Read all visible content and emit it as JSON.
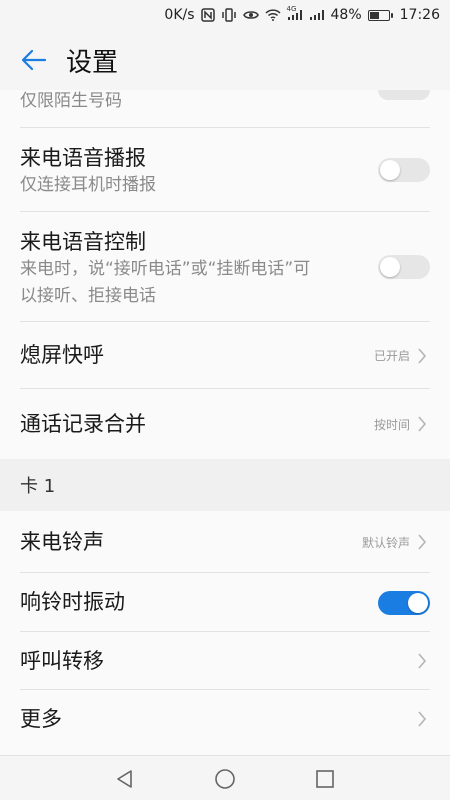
{
  "status_bar": {
    "speed": "0K/s",
    "network_label": "4G",
    "battery": "48%",
    "battery_level": 0.48,
    "time": "17:26"
  },
  "header": {
    "title": "设置"
  },
  "rows": {
    "partial": {
      "sub": "仅限陌生号码"
    },
    "voice_broadcast": {
      "title": "来电语音播报",
      "sub": "仅连接耳机时播报",
      "on": false
    },
    "voice_control": {
      "title": "来电语音控制",
      "sub": "来电时，说“接听电话”或“挂断电话”可以接听、拒接电话",
      "on": false
    },
    "quick_call": {
      "title": "熄屏快呼",
      "value": "已开启"
    },
    "merge_log": {
      "title": "通话记录合并",
      "value": "按时间"
    }
  },
  "section_card1": {
    "label": "卡 1"
  },
  "card_rows": {
    "ringtone": {
      "title": "来电铃声",
      "value": "默认铃声"
    },
    "vibrate": {
      "title": "响铃时振动",
      "on": true
    },
    "forwarding": {
      "title": "呼叫转移"
    },
    "more": {
      "title": "更多"
    }
  },
  "colors": {
    "accent": "#1a7de2",
    "switch_off": "#e6e6e6"
  }
}
